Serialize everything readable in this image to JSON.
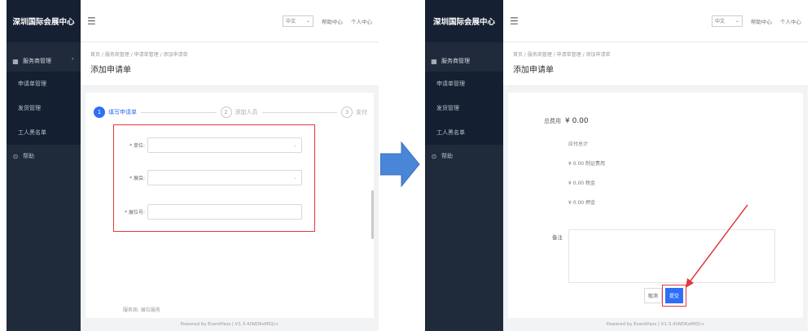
{
  "left_screen": {
    "brand": "深圳国际会展中心",
    "sidebar": {
      "group_label": "服务商管理",
      "items": [
        "申请单管理",
        "发货管理",
        "工人黑名单"
      ],
      "single_item": "帮助"
    },
    "topbar": {
      "language": "中文",
      "help": "帮助中心",
      "user": "个人中心"
    },
    "breadcrumb": "首页 / 服务商管理 / 申请单管理 / 添加申请单",
    "page_title": "添加申请单",
    "steps": [
      "填写申请单",
      "添加人员",
      "支付"
    ],
    "fields": [
      {
        "label": "* 单位:",
        "value": ""
      },
      {
        "label": "* 展会:",
        "value": ""
      },
      {
        "label": "* 展位号:",
        "value": ""
      }
    ],
    "cut_text": "服务商: 展位服务",
    "footer": "Powered by EventPass | V1.3.4(WD6xMIQ)+"
  },
  "right_screen": {
    "brand": "深圳国际会展中心",
    "sidebar": {
      "group_label": "服务商管理",
      "items": [
        "申请单管理",
        "发货管理",
        "工人黑名单"
      ],
      "single_item": "帮助"
    },
    "topbar": {
      "language": "中文",
      "help": "帮助中心",
      "user": "个人中心"
    },
    "breadcrumb": "首页 / 服务商管理 / 申请单管理 / 添加申请单",
    "page_title": "添加申请单",
    "fee_total_label": "总费用",
    "fee_total_value": "¥ 0.00",
    "fee_section": "应付总计",
    "fee_lines": [
      "¥ 0.00  制证费用",
      "¥ 0.00  税金",
      "¥ 0.00  押金"
    ],
    "remark_label": "备注",
    "cancel_label": "取消",
    "submit_label": "提交",
    "footer": "Powered by EventPass | V1.3.4(WD6xMIQ)+"
  },
  "colors": {
    "sidebar": "#1f2a3a",
    "accent": "#2d6ff7",
    "highlight": "#e0393e",
    "flow_arrow": "#4a86d8"
  }
}
